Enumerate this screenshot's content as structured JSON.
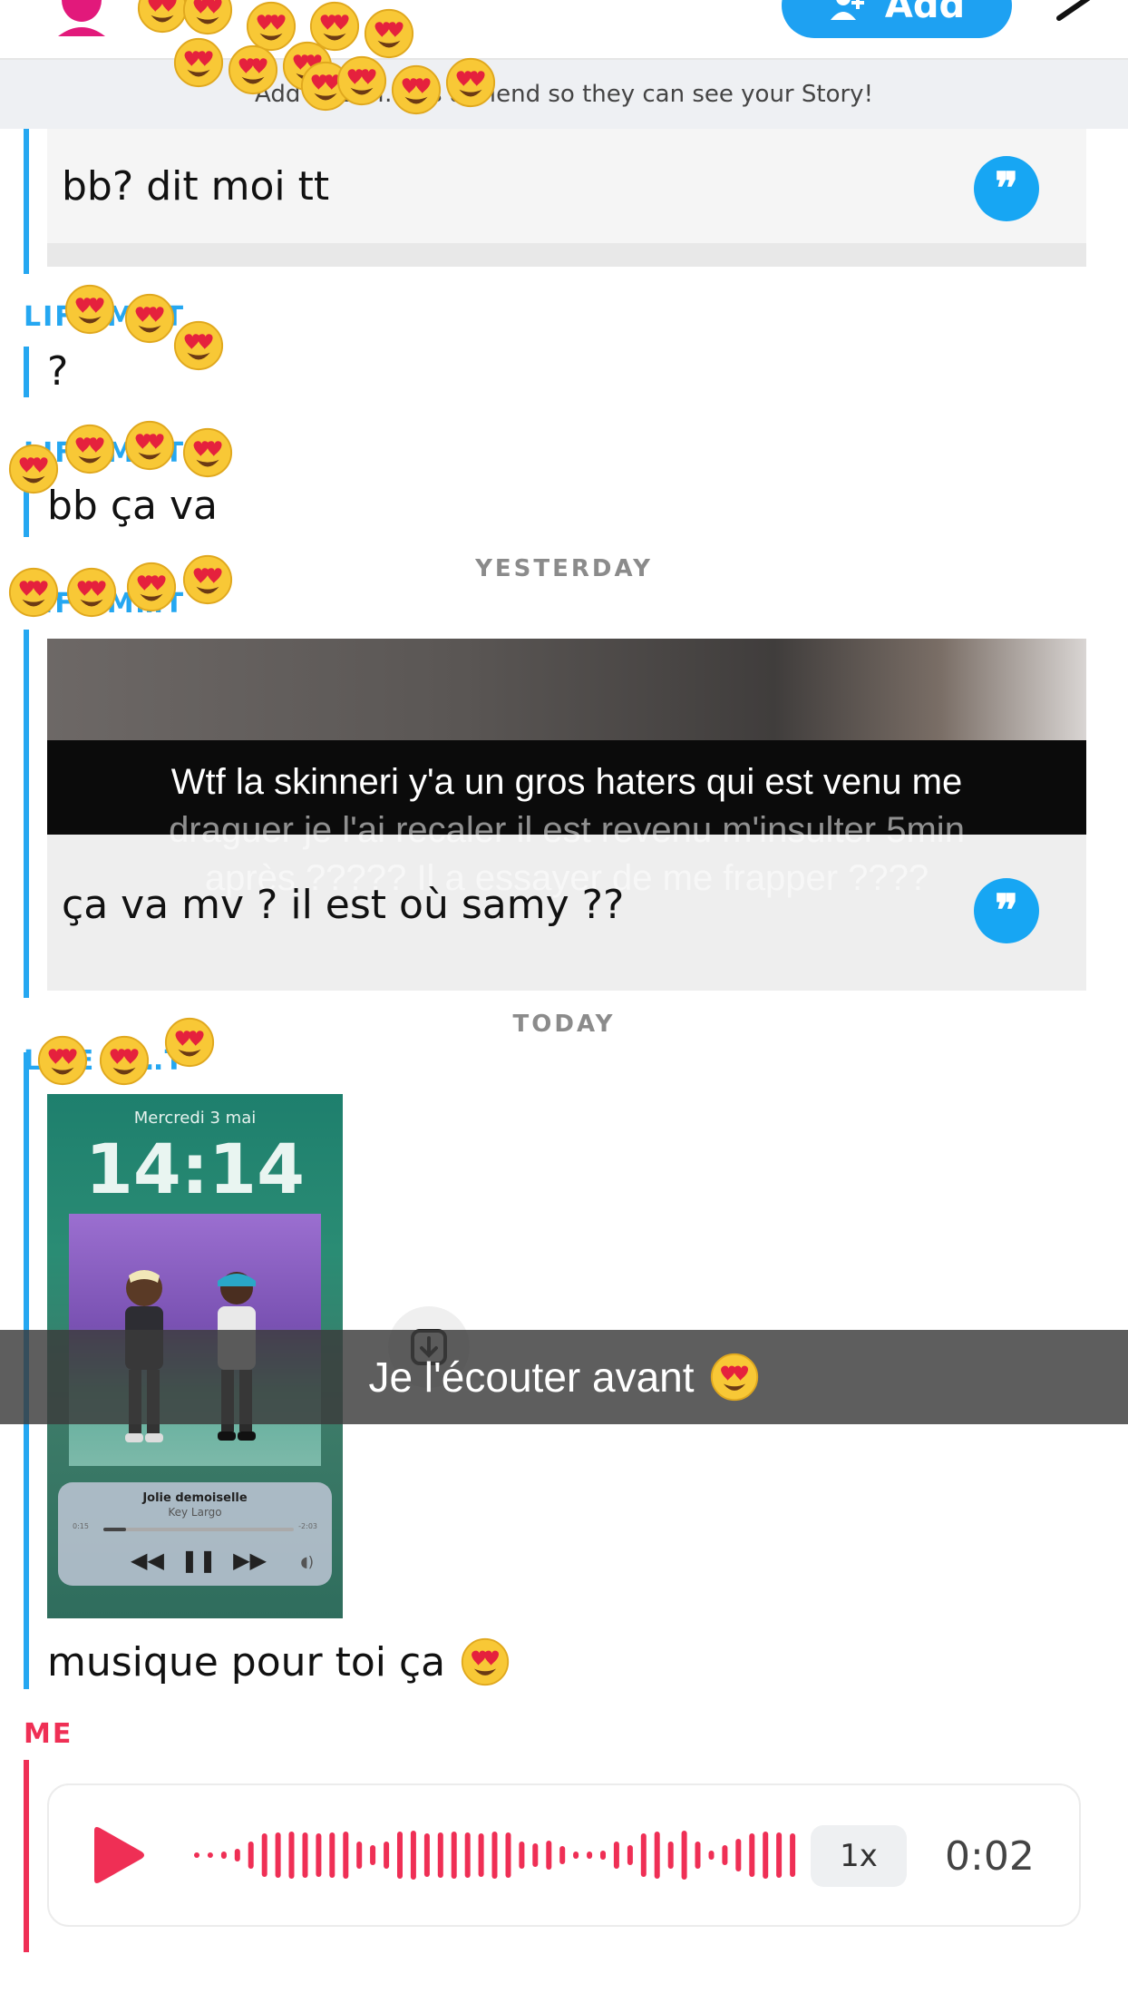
{
  "header": {
    "add_label": "Add"
  },
  "banner": {
    "text": "Add LIFE M… as a friend so they can see your Story!"
  },
  "thread": {
    "quoted_message_1": "bb? dit moi tt",
    "sender_1": "LIFE M…T",
    "message_1": "?",
    "sender_2": "LIFE M…T",
    "message_2": "bb ça va",
    "date_separator_1": "YESTERDAY",
    "sender_3": "LIFE M…T",
    "snap_caption_line1": "Wtf la skinneri y'a un gros haters qui est venu me",
    "snap_caption_line2": "draguer je l'ai recaler il est revenu m'insulter 5min",
    "snap_caption_line3": "après ????? Il a essayer de me frapper ????",
    "snap_reply": "ça va mv ? il est où samy ??",
    "date_separator_2": "TODAY",
    "sender_4": "LIFE M…T",
    "lockscreen_date": "Mercredi 3 mai",
    "lockscreen_time": "14:14",
    "song_title": "Jolie demoiselle",
    "song_artist": "Key Largo",
    "song_elapsed": "0:15",
    "song_remaining": "-2:03",
    "song_progress": 0.12,
    "overlay_caption": "Je l'écouter avant",
    "message_4": "musique pour toi ça",
    "sender_me": "ME",
    "voice_speed": "1x",
    "voice_duration": "0:02"
  },
  "colors": {
    "friend_accent": "#25a7f1",
    "me_accent": "#ef2f55",
    "add_button": "#1ea1f2"
  },
  "icons": {
    "quote": "quote-reply-icon",
    "play": "play-icon",
    "download": "download-icon",
    "emoji": "heart-eyes-emoji"
  }
}
